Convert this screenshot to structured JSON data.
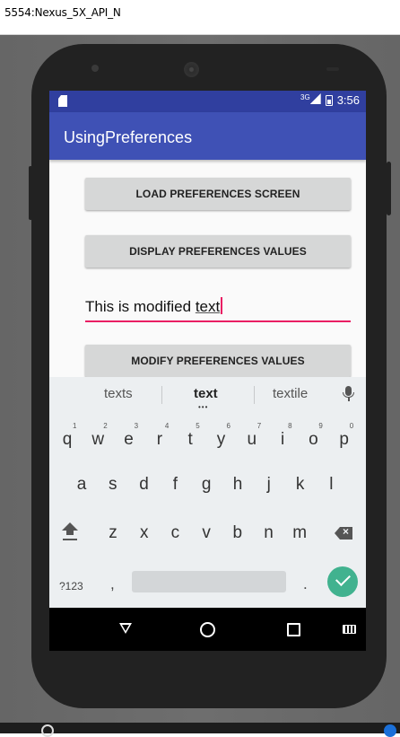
{
  "window": {
    "title": "5554:Nexus_5X_API_N"
  },
  "statusbar": {
    "network": "3G",
    "time": "3:56"
  },
  "app": {
    "title": "UsingPreferences"
  },
  "buttons": {
    "load": "LOAD PREFERENCES SCREEN",
    "display": "DISPLAY PREFERENCES VALUES",
    "modify": "MODIFY PREFERENCES VALUES"
  },
  "edit_field": {
    "text_prefix": "This is modified ",
    "text_word": "text"
  },
  "keyboard": {
    "suggestions": [
      "texts",
      "text",
      "textile"
    ],
    "row1": [
      {
        "key": "q",
        "num": "1"
      },
      {
        "key": "w",
        "num": "2"
      },
      {
        "key": "e",
        "num": "3"
      },
      {
        "key": "r",
        "num": "4"
      },
      {
        "key": "t",
        "num": "5"
      },
      {
        "key": "y",
        "num": "6"
      },
      {
        "key": "u",
        "num": "7"
      },
      {
        "key": "i",
        "num": "8"
      },
      {
        "key": "o",
        "num": "9"
      },
      {
        "key": "p",
        "num": "0"
      }
    ],
    "row2": [
      "a",
      "s",
      "d",
      "f",
      "g",
      "h",
      "j",
      "k",
      "l"
    ],
    "row3": [
      "z",
      "x",
      "c",
      "v",
      "b",
      "n",
      "m"
    ],
    "symbols_label": "?123",
    "comma": ",",
    "period": "."
  },
  "icons": {
    "sd_card": "sd-card-icon",
    "signal": "signal-icon",
    "battery": "battery-icon",
    "mic": "mic-icon",
    "shift": "shift-icon",
    "backspace": "backspace-icon",
    "enter": "checkmark-icon",
    "back": "back-icon",
    "home": "home-icon",
    "recents": "recents-icon",
    "keyboard_switch": "keyboard-icon"
  },
  "colors": {
    "primary": "#3f51b5",
    "primary_dark": "#303f9f",
    "accent": "#e91e63",
    "enter_key": "#41b28f",
    "button_bg": "#d6d7d7"
  }
}
